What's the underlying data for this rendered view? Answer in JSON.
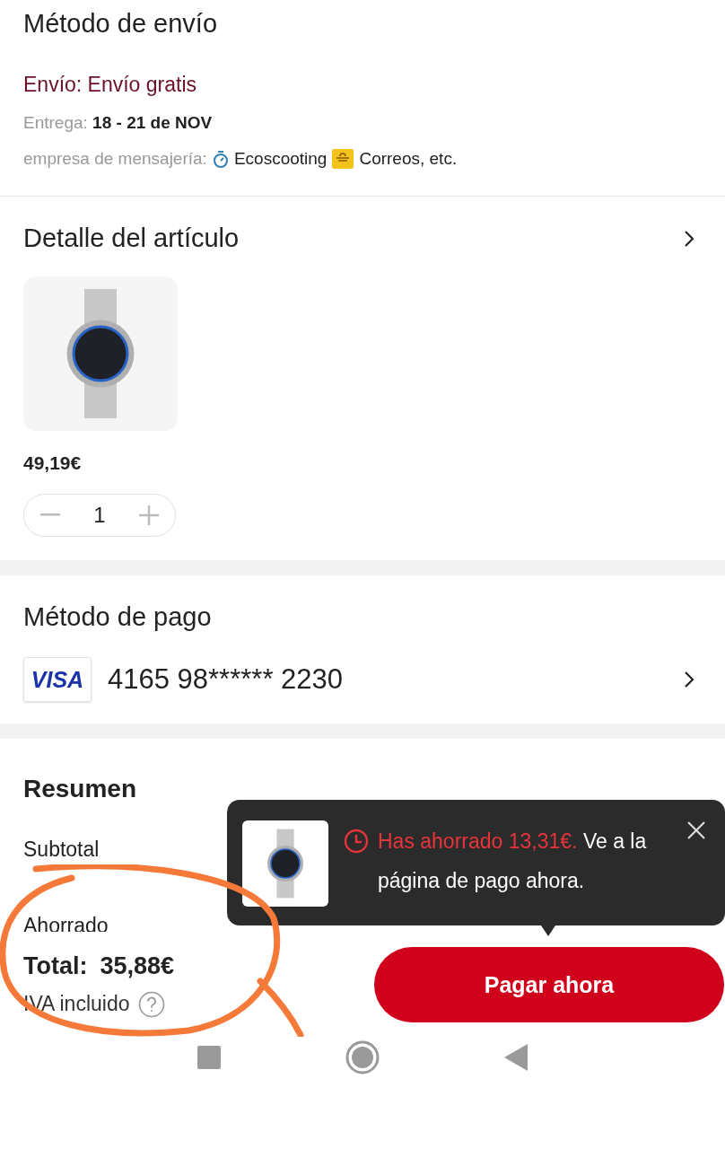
{
  "shipping": {
    "title": "Método de envío",
    "method": "Envío: Envío gratis",
    "delivery_label": "Entrega:",
    "delivery_dates": "18 - 21 de NOV",
    "carrier_label": "empresa de mensajería:",
    "carriers": [
      "Ecoscooting",
      "Correos, etc."
    ]
  },
  "item_detail": {
    "title": "Detalle del artículo",
    "price": "49,19€",
    "quantity": "1"
  },
  "payment": {
    "title": "Método de pago",
    "card_brand": "VISA",
    "card_number": "4165 98****** 2230"
  },
  "summary": {
    "title": "Resumen",
    "rows": [
      {
        "label": "Subtotal"
      },
      {
        "label": "Ahorrado"
      }
    ]
  },
  "popup": {
    "highlight": "Has ahorrado 13,31€.",
    "message": "Ve a la página de pago ahora."
  },
  "footer": {
    "total_label": "Total:",
    "total": "35,88€",
    "tax_note": "IVA incluido",
    "pay_button": "Pagar ahora"
  }
}
